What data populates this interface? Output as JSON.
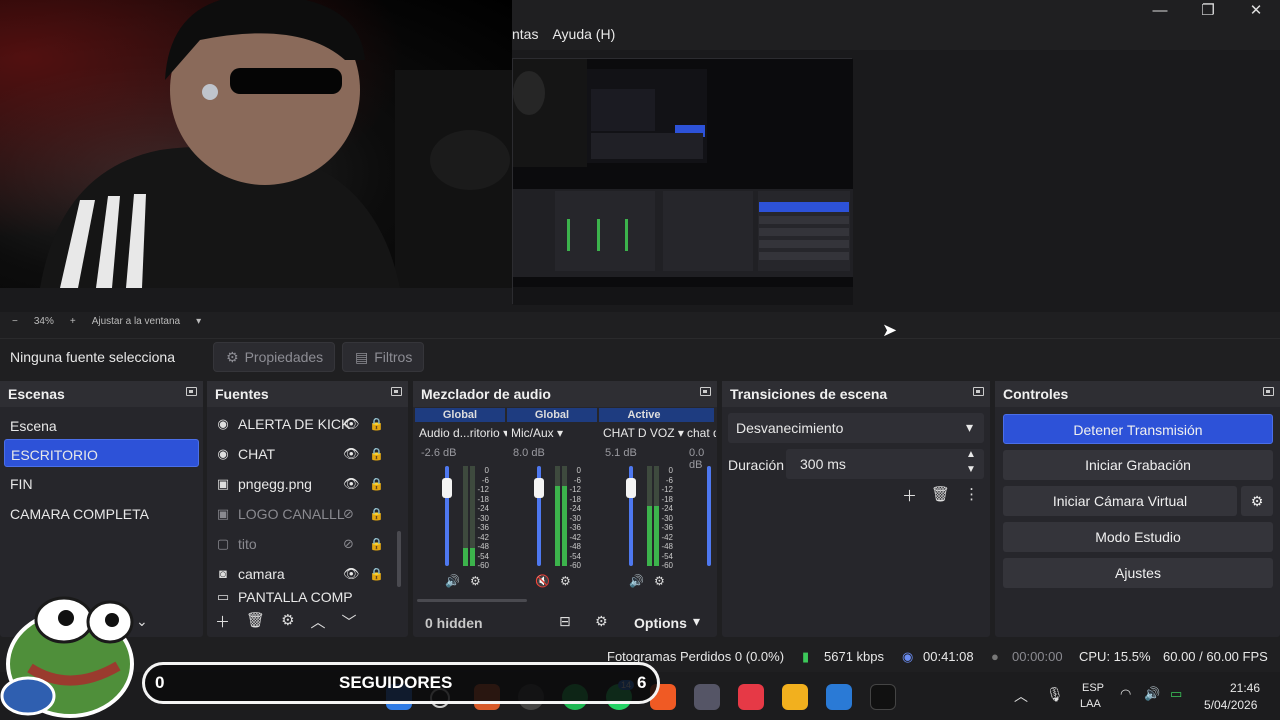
{
  "menu": {
    "items": [
      "ntas",
      "Ayuda (H)"
    ]
  },
  "window": {
    "min": "—",
    "max": "❐",
    "close": "✕"
  },
  "zoom": {
    "minus": "−",
    "value": "34%",
    "plus": "+",
    "fit": "Ajustar a la ventana"
  },
  "source_bar": {
    "label": "Ninguna fuente selecciona",
    "properties": "Propiedades",
    "filters": "Filtros"
  },
  "scenes": {
    "title": "Escenas",
    "items": [
      "Escena",
      "ESCRITORIO",
      "FIN",
      "CAMARA COMPLETA"
    ],
    "selected": "ESCRITORIO"
  },
  "sources": {
    "title": "Fuentes",
    "items": [
      {
        "name": "ALERTA DE KICK",
        "icon": "globe-icon"
      },
      {
        "name": "CHAT",
        "icon": "globe-icon"
      },
      {
        "name": "pngegg.png",
        "icon": "image-icon"
      },
      {
        "name": "LOGO CANALLL",
        "icon": "image-icon"
      },
      {
        "name": "tito",
        "icon": "window-icon"
      },
      {
        "name": "camara",
        "icon": "camera-icon"
      },
      {
        "name": "PANTALLA COMP",
        "icon": "monitor-icon"
      }
    ]
  },
  "mixer": {
    "title": "Mezclador de audio",
    "channels": [
      {
        "header": "Global",
        "name": "Audio d...ritorio",
        "db": "-2.6 dB",
        "level": 0.18
      },
      {
        "header": "Global",
        "name": "Mic/Aux",
        "db": "8.0 dB",
        "level": 0.8
      },
      {
        "header": "Active",
        "name": "CHAT D VOZ",
        "db": "5.1 dB",
        "level": 0.6
      },
      {
        "header": "",
        "name": "chat d",
        "db": "0.0 dB",
        "level": 0.0
      }
    ],
    "scale": [
      "0",
      "-6",
      "-12",
      "-18",
      "-24",
      "-30",
      "-36",
      "-42",
      "-48",
      "-54",
      "-60"
    ],
    "hidden": "0 hidden",
    "options": "Options"
  },
  "transitions": {
    "title": "Transiciones de escena",
    "selected": "Desvanecimiento",
    "duration_label": "Duración",
    "duration": "300 ms"
  },
  "controls": {
    "title": "Controles",
    "stop_stream": "Detener Transmisión",
    "start_record": "Iniciar Grabación",
    "virtual_cam": "Iniciar Cámara Virtual",
    "studio": "Modo Estudio",
    "settings": "Ajustes"
  },
  "status": {
    "dropped": "Fotogramas Perdidos 0 (0.0%)",
    "bitrate": "5671 kbps",
    "stream_time": "00:41:08",
    "rec_time": "00:00:00",
    "cpu": "CPU: 15.5%",
    "fps": "60.00 / 60.00 FPS"
  },
  "overlay": {
    "followers_label": "SEGUIDORES",
    "followers_count": "0",
    "goal": "6"
  },
  "taskbar": {
    "lang": "ESP",
    "region": "LAA",
    "time": "21:46",
    "date": "5/04/2026",
    "notif": "14"
  },
  "colors": {
    "accent": "#2d52d8",
    "panel": "#26262b",
    "bg": "#1f1f21"
  }
}
